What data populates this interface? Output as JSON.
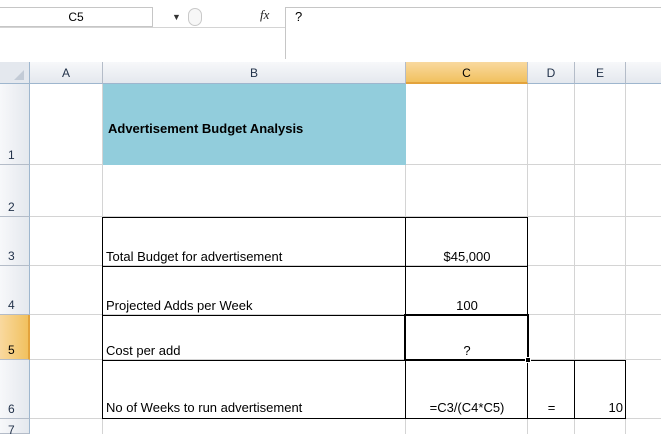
{
  "formula_bar": {
    "name_box": "C5",
    "fx_label": "fx",
    "formula": "?"
  },
  "columns": [
    "A",
    "B",
    "C",
    "D",
    "E"
  ],
  "selected_column": "C",
  "rows": [
    "1",
    "2",
    "3",
    "4",
    "5",
    "6",
    "7"
  ],
  "selected_row": "5",
  "colors": {
    "title_fill": "#92cddc",
    "selected_header": "#f1c15f"
  },
  "sheet": {
    "title": "Advertisement Budget Analysis",
    "table": [
      {
        "label": "Total Budget for advertisement",
        "value": "$45,000"
      },
      {
        "label": "Projected Adds per Week",
        "value": "100"
      },
      {
        "label": "Cost per add",
        "value": "?"
      },
      {
        "label": "No of Weeks to run advertisement",
        "value": "=C3/(C4*C5)",
        "equals": "=",
        "result": "10"
      }
    ]
  }
}
